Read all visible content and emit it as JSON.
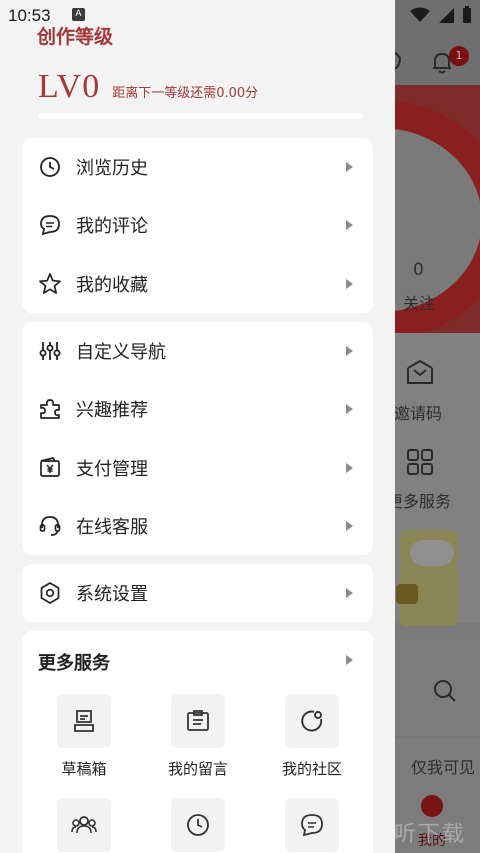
{
  "status_bar": {
    "time": "10:53",
    "notification_badge": "A"
  },
  "background": {
    "follow_count": "0",
    "follow_label": "关注",
    "invite_code_label": "邀请码",
    "more_services_label": "更多服务",
    "visibility_label": "仅我可见",
    "nav_mine_label": "我的",
    "message_badge": "1",
    "watermark_glyph": "听",
    "watermark_text": "一听下载"
  },
  "level": {
    "title": "创作等级",
    "value": "LV0",
    "hint": "距离下一等级还需0.00分",
    "progress_percent": 0
  },
  "menu_group_1": [
    {
      "label": "浏览历史",
      "icon": "clock-icon"
    },
    {
      "label": "我的评论",
      "icon": "chat-icon"
    },
    {
      "label": "我的收藏",
      "icon": "star-icon"
    }
  ],
  "menu_group_2": [
    {
      "label": "自定义导航",
      "icon": "sliders-icon"
    },
    {
      "label": "兴趣推荐",
      "icon": "puzzle-icon"
    },
    {
      "label": "支付管理",
      "icon": "wallet-icon"
    },
    {
      "label": "在线客服",
      "icon": "headset-icon"
    }
  ],
  "menu_group_3": [
    {
      "label": "系统设置",
      "icon": "hexagon-settings-icon"
    }
  ],
  "more_services": {
    "title": "更多服务",
    "items": [
      {
        "label": "草稿箱",
        "icon": "drafts-icon"
      },
      {
        "label": "我的留言",
        "icon": "message-board-icon"
      },
      {
        "label": "我的社区",
        "icon": "community-icon"
      },
      {
        "label": "",
        "icon": "group-icon"
      },
      {
        "label": "",
        "icon": "clock-icon"
      },
      {
        "label": "",
        "icon": "chat-icon"
      }
    ]
  },
  "colors": {
    "accent": "#a33838",
    "drawer_bg": "#f3f3f3",
    "card_bg": "#ffffff"
  }
}
